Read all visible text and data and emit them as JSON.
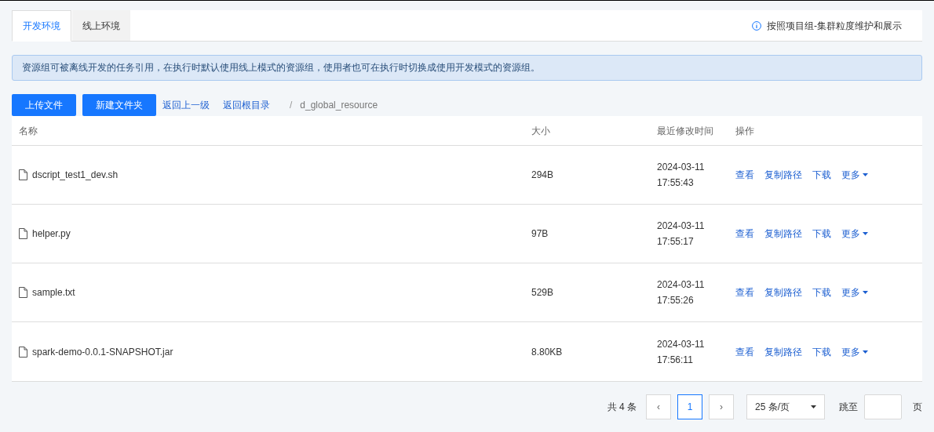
{
  "tabs": [
    {
      "label": "开发环境",
      "selected": true
    },
    {
      "label": "线上环境",
      "selected": false
    }
  ],
  "info_note": "按照项目组-集群粒度维护和展示",
  "alert": "资源组可被离线开发的任务引用，在执行时默认使用线上模式的资源组，使用者也可在执行时切换成使用开发模式的资源组。",
  "toolbar": {
    "buttons": [
      "上传文件",
      "新建文件夹"
    ],
    "links": [
      "返回上一级",
      "返回根目录"
    ],
    "separator": "/",
    "path": "d_global_resource"
  },
  "table": {
    "columns": [
      "名称",
      "大小",
      "最近修改时间",
      "操作"
    ],
    "rows": [
      {
        "name": "dscript_test1_dev.sh",
        "size": "294B",
        "date": "2024-03-11",
        "time": "17:55:43",
        "actions": [
          "查看",
          "复制路径",
          "下载",
          "更多"
        ]
      },
      {
        "name": "helper.py",
        "size": "97B",
        "date": "2024-03-11",
        "time": "17:55:17",
        "actions": [
          "查看",
          "复制路径",
          "下载",
          "更多"
        ]
      },
      {
        "name": "sample.txt",
        "size": "529B",
        "date": "2024-03-11",
        "time": "17:55:26",
        "actions": [
          "查看",
          "复制路径",
          "下载",
          "更多"
        ]
      },
      {
        "name": "spark-demo-0.0.1-SNAPSHOT.jar",
        "size": "8.80KB",
        "date": "2024-03-11",
        "time": "17:56:11",
        "actions": [
          "查看",
          "复制路径",
          "下载",
          "更多"
        ]
      }
    ]
  },
  "pagination": {
    "total": "共 4 条",
    "prev": "‹",
    "pages": [
      {
        "label": "1",
        "selected": true
      }
    ],
    "next": "›",
    "page_size": "25 条/页",
    "jump_label": "跳至",
    "jump_suffix": "页"
  }
}
